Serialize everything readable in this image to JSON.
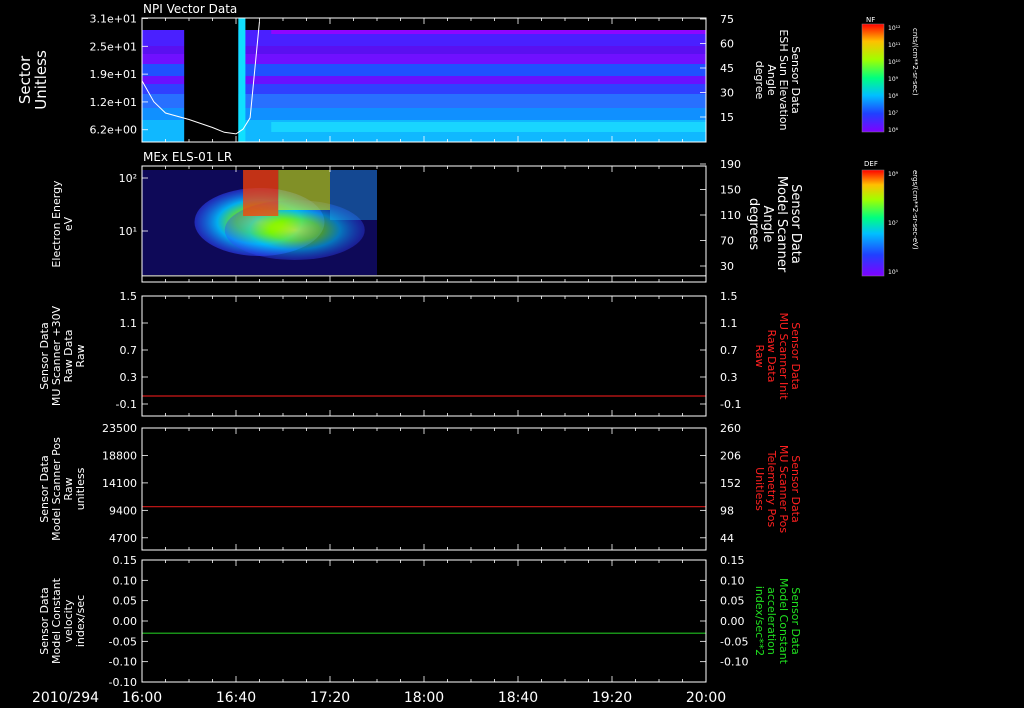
{
  "date_label": "2010/294",
  "time_ticks": [
    "16:00",
    "16:40",
    "17:20",
    "18:00",
    "18:40",
    "19:20",
    "20:00"
  ],
  "chart_data": [
    {
      "type": "heatmap",
      "title": "NPI Vector Data",
      "ylabel": [
        "Sector",
        "Unitless"
      ],
      "yticks": [
        "3.1e+01",
        "2.5e+01",
        "1.9e+01",
        "1.2e+01",
        "6.2e+00"
      ],
      "right_ylabel": [
        "Sensor Data",
        "ESH Sun Elevation",
        "Angle",
        "degree"
      ],
      "right_yticks": [
        "75",
        "60",
        "45",
        "30",
        "15"
      ],
      "right_ylabel_color": "#ffffff",
      "colorbar": {
        "label": "NF",
        "ticks": [
          "10¹²",
          "10¹¹",
          "10¹⁰",
          "10⁹",
          "10⁸",
          "10⁷",
          "10⁶"
        ],
        "units": "cnts/(cm**2-sr-sec)"
      },
      "overlay_line_color": "#ffffff",
      "overlay_line": {
        "x": [
          "16:00",
          "16:05",
          "16:10",
          "16:20",
          "16:30",
          "16:35",
          "16:40",
          "16:43",
          "16:46",
          "16:50"
        ],
        "y": [
          38,
          25,
          18,
          14,
          9,
          6,
          5,
          8,
          15,
          75
        ]
      },
      "data_gap": [
        "16:18",
        "16:35"
      ],
      "data_end": "20:00"
    },
    {
      "type": "heatmap",
      "title": "MEx ELS-01 LR",
      "ylabel": [
        "Electron Energy",
        "eV"
      ],
      "yticks": [
        "10²",
        "10¹"
      ],
      "right_ylabel": [
        "Sensor Data",
        "Model Scanner",
        "Angle",
        "degrees"
      ],
      "right_yticks": [
        "190",
        "150",
        "110",
        "70",
        "30"
      ],
      "right_ylabel_color": "#ffffff",
      "colorbar": {
        "label": "DEF",
        "ticks": [
          "10⁹",
          "10⁷",
          "10⁵"
        ],
        "units": "ergs/(cm**2-sr-sec-eV)"
      },
      "overlay_line_color": "#ffffff",
      "overlay_line": {
        "x": [
          "16:00",
          "20:00"
        ],
        "y": [
          10,
          10
        ]
      },
      "data_end": "17:40"
    },
    {
      "type": "line",
      "ylabel": [
        "Sensor Data",
        "MU Scanner +30V",
        "Raw Data",
        "Raw"
      ],
      "yticks": [
        "1.5",
        "1.1",
        "0.7",
        "0.3",
        "-0.1"
      ],
      "ylim": [
        -0.3,
        1.5
      ],
      "right_ylabel": [
        "Sensor Data",
        "MU Scanner Init",
        "Raw Data",
        "Raw"
      ],
      "right_yticks": [
        "1.5",
        "1.1",
        "0.7",
        "0.3",
        "-0.1"
      ],
      "right_ylabel_color": "#ff2020",
      "series": [
        {
          "color": "#d01818",
          "x": [
            "16:00",
            "20:00"
          ],
          "y": [
            0.0,
            0.0
          ]
        }
      ]
    },
    {
      "type": "line",
      "ylabel": [
        "Sensor Data",
        "Model Scanner Pos",
        "Raw",
        "unitless"
      ],
      "yticks": [
        "23500",
        "18800",
        "14100",
        "9400",
        "4700"
      ],
      "ylim": [
        0,
        23500
      ],
      "right_ylabel": [
        "Sensor Data",
        "MU Scanner Pos",
        "Telemetry Pos",
        "Unitless"
      ],
      "right_yticks": [
        "260",
        "206",
        "152",
        "98",
        "44"
      ],
      "right_ylabel_color": "#ff2020",
      "series": [
        {
          "color": "#d01818",
          "x": [
            "16:00",
            "20:00"
          ],
          "y": [
            8350,
            8350
          ]
        }
      ]
    },
    {
      "type": "line",
      "ylabel": [
        "Sensor Data",
        "Model Constant",
        "velocity",
        "index/sec"
      ],
      "yticks": [
        "0.15",
        "0.10",
        "0.05",
        "0.00",
        "-0.05",
        "-0.10"
      ],
      "ylim": [
        -0.1,
        0.15
      ],
      "right_ylabel": [
        "Sensor Data",
        "Model Constant",
        "acceleration",
        "index/sec**2"
      ],
      "right_yticks": [
        "0.15",
        "0.10",
        "0.05",
        "0.00",
        "-0.05",
        "-0.10"
      ],
      "right_ylabel_color": "#20e020",
      "series": [
        {
          "color": "#20c020",
          "x": [
            "16:00",
            "20:00"
          ],
          "y": [
            0.0,
            0.0
          ]
        }
      ]
    }
  ]
}
